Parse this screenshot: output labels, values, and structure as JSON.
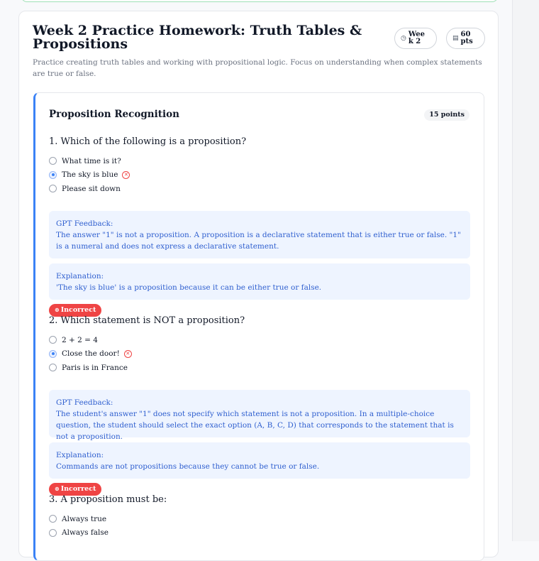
{
  "homework": {
    "title": "Week 2 Practice Homework: Truth Tables & Propositions",
    "week_label": "Week 2",
    "points_label": "60 pts",
    "description": "Practice creating truth tables and working with propositional logic. Focus on understanding when complex statements are true or false."
  },
  "section": {
    "title": "Proposition Recognition",
    "points": "15 points",
    "accent_color": "#3b82f6"
  },
  "questions": [
    {
      "text": "1. Which of the following is a proposition?",
      "options": [
        "What time is it?",
        "The sky is blue",
        "Please sit down"
      ],
      "selected": 1,
      "feedback_label": "GPT Feedback:",
      "feedback": "The answer \"1\" is not a proposition. A proposition is a declarative statement that is either true or false. \"1\" is a numeral and does not express a declarative statement.",
      "explanation_label": "Explanation:",
      "explanation": "'The sky is blue' is a proposition because it can be either true or false.",
      "status": "Incorrect"
    },
    {
      "text": "2. Which statement is NOT a proposition?",
      "options": [
        "2 + 2 = 4",
        "Close the door!",
        "Paris is in France"
      ],
      "selected": 1,
      "feedback_label": "GPT Feedback:",
      "feedback": "The student's answer \"1\" does not specify which statement is not a proposition. In a multiple-choice question, the student should select the exact option (A, B, C, D) that corresponds to the statement that is not a proposition.",
      "explanation_label": "Explanation:",
      "explanation": "Commands are not propositions because they cannot be true or false.",
      "status": "Incorrect"
    },
    {
      "text": "3. A proposition must be:",
      "options": [
        "Always true",
        "Always false"
      ]
    }
  ],
  "icons": {
    "week": "clock-icon",
    "points": "document-icon",
    "wrong": "x-circle-icon"
  },
  "colors": {
    "incorrect": "#ef4444",
    "feedback_bg": "#eef4ff",
    "feedback_text": "#2f5fcf"
  }
}
